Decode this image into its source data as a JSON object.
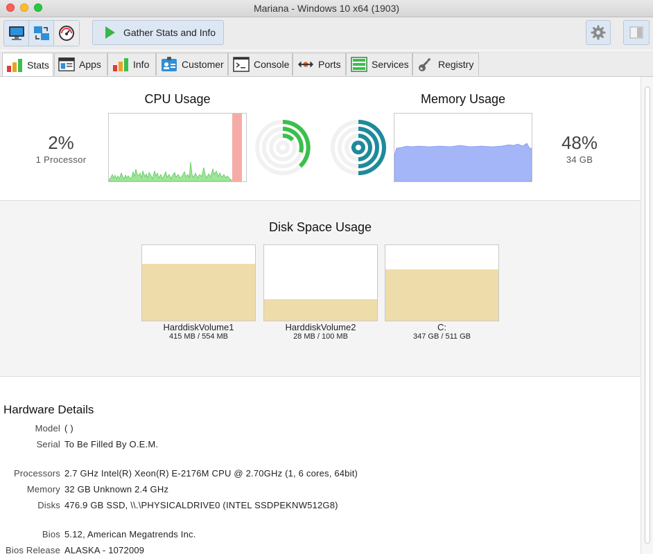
{
  "window": {
    "title": "Mariana - Windows 10 x64 (1903)"
  },
  "toolbar": {
    "buttons": [
      "monitor-icon",
      "transfer-icon",
      "gauge-icon"
    ],
    "gather_label": "Gather Stats and Info"
  },
  "tabs": [
    {
      "label": "Stats",
      "active": true
    },
    {
      "label": "Apps"
    },
    {
      "label": "Info"
    },
    {
      "label": "Customer"
    },
    {
      "label": "Console"
    },
    {
      "label": "Ports"
    },
    {
      "label": "Services"
    },
    {
      "label": "Registry"
    }
  ],
  "cpu": {
    "title": "CPU Usage",
    "percent": "2%",
    "detail": "1 Processor",
    "color": "#3bbf4c"
  },
  "memory": {
    "title": "Memory Usage",
    "percent": "48%",
    "detail": "34 GB",
    "color": "#1e8a9a"
  },
  "disk": {
    "title": "Disk Space Usage",
    "volumes": [
      {
        "name": "HarddiskVolume1",
        "size": "415 MB / 554 MB",
        "used_fraction": 0.749
      },
      {
        "name": "HarddiskVolume2",
        "size": "28 MB / 100 MB",
        "used_fraction": 0.28
      },
      {
        "name": "C:",
        "size": "347 GB / 511 GB",
        "used_fraction": 0.679
      }
    ]
  },
  "hardware": {
    "title": "Hardware Details",
    "rows": [
      {
        "label": "Model",
        "value": "( )"
      },
      {
        "label": "Serial",
        "value": "To Be Filled By O.E.M."
      },
      {
        "label": "Processors",
        "value": "2.7 GHz Intel(R) Xeon(R) E-2176M  CPU @ 2.70GHz (1, 6 cores, 64bit)"
      },
      {
        "label": "Memory",
        "value": "32 GB Unknown 2.4 GHz"
      },
      {
        "label": "Disks",
        "value": "476.9 GB SSD, \\\\.\\PHYSICALDRIVE0 (INTEL SSDPEKNW512G8)"
      },
      {
        "label": "Bios",
        "value": "5.12, American Megatrends Inc."
      },
      {
        "label": "Bios Release",
        "value": "ALASKA - 1072009"
      }
    ]
  }
}
